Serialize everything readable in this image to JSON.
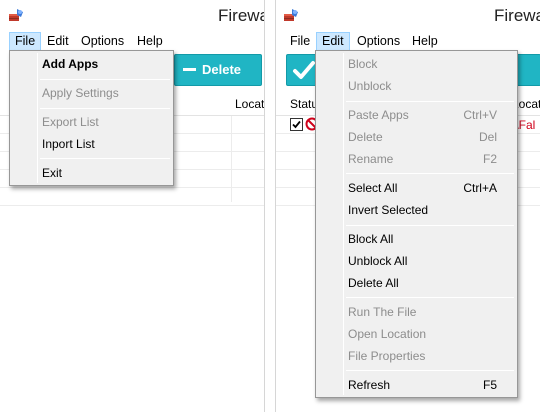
{
  "window_title": "Firewa",
  "menu": {
    "file": "File",
    "edit": "Edit",
    "options": "Options",
    "help": "Help"
  },
  "toolbar": {
    "delete_label": "Delete"
  },
  "columns": {
    "status": "Statu",
    "location": "Locati"
  },
  "row": {
    "path_fragment": ":\\Fal"
  },
  "file_menu": {
    "add_apps": "Add Apps",
    "apply_settings": "Apply Settings",
    "export_list": "Export List",
    "inport_list": "Inport List",
    "exit": "Exit"
  },
  "edit_menu": {
    "block": "Block",
    "unblock": "Unblock",
    "paste_apps": {
      "label": "Paste Apps",
      "shortcut": "Ctrl+V"
    },
    "delete": {
      "label": "Delete",
      "shortcut": "Del"
    },
    "rename": {
      "label": "Rename",
      "shortcut": "F2"
    },
    "select_all": {
      "label": "Select All",
      "shortcut": "Ctrl+A"
    },
    "invert_selected": "Invert Selected",
    "block_all": "Block All",
    "unblock_all": "Unblock All",
    "delete_all": "Delete All",
    "run_the_file": "Run The File",
    "open_location": "Open Location",
    "file_properties": "File Properties",
    "refresh": {
      "label": "Refresh",
      "shortcut": "F5"
    }
  },
  "icons": {
    "app": "firewall-app-icon",
    "minus": "minus-icon",
    "checkmark": "checkmark-icon",
    "blocked": "blocked-icon",
    "checkbox": "checkbox-checked-icon"
  },
  "colors": {
    "toolbar_button": "#20b5c4",
    "menu_highlight": "#cde8ff",
    "blocked_red": "#d0021b"
  }
}
